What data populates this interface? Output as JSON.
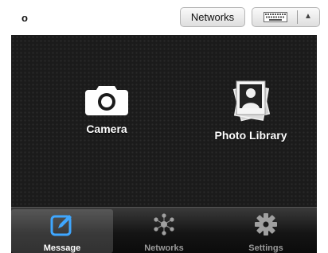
{
  "compose": {
    "text": "o"
  },
  "toolbar": {
    "networks_label": "Networks"
  },
  "picker": {
    "options": [
      {
        "label": "Camera",
        "icon": "camera-icon"
      },
      {
        "label": "Photo Library",
        "icon": "photo-library-icon"
      }
    ]
  },
  "tabbar": {
    "items": [
      {
        "label": "Message",
        "icon": "compose-icon",
        "selected": true
      },
      {
        "label": "Networks",
        "icon": "network-icon",
        "selected": false
      },
      {
        "label": "Settings",
        "icon": "gear-icon",
        "selected": false
      }
    ]
  },
  "colors": {
    "accent": "#3fa7ff",
    "panel_bg": "#1b1b1b",
    "tabbar_bg": "#151515"
  }
}
